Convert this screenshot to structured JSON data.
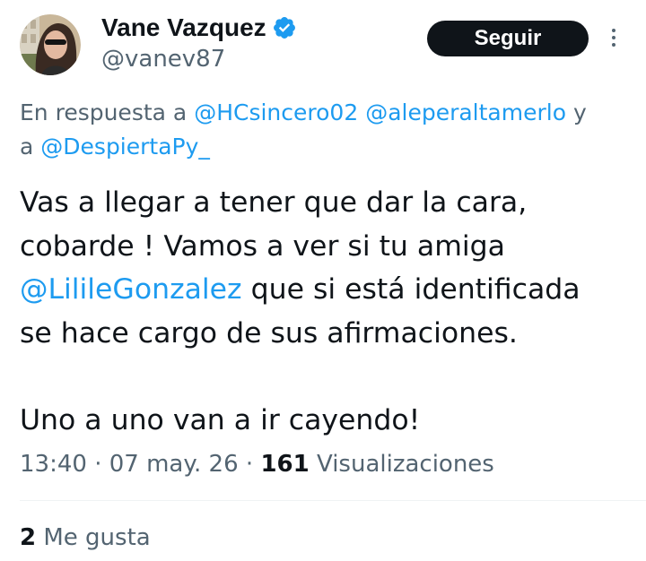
{
  "author": {
    "display_name": "Vane Vazquez",
    "handle": "@vanev87",
    "verified": true,
    "avatar_icon": "profile-photo"
  },
  "header": {
    "follow_label": "Seguir",
    "more_icon": "more-vertical-icon"
  },
  "reply_context": {
    "prefix": "En respuesta a",
    "mentions": [
      "@HCsincero02",
      "@aleperaltamerlo",
      "@DespiertaPy_"
    ],
    "connector": "y",
    "line2_prefix": "a"
  },
  "tweet": {
    "line1": "Vas a llegar a tener que dar la cara,",
    "line2": "cobarde ! Vamos a ver si tu amiga",
    "mention": "@LilileGonzalez",
    "line3_rest": " que si está identificada",
    "line4": "se hace cargo de sus afirmaciones.",
    "line5": "Uno a uno van a ir cayendo!"
  },
  "meta": {
    "time": "13:40",
    "separator": " · ",
    "date": "07 may. 26",
    "views_count": "161",
    "views_label": " Visualizaciones"
  },
  "stats": {
    "likes_count": "2",
    "likes_label": " Me gusta"
  },
  "colors": {
    "accent": "#1d9bf0",
    "text": "#0f1419",
    "secondary": "#536471",
    "button_bg": "#0f1419",
    "divider": "#eff3f4"
  }
}
